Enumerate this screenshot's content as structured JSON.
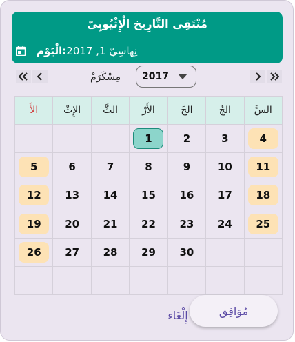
{
  "header": {
    "title": "مُنْتَقِي التَّارِيخ الْإِثْيُوبِيّ",
    "today_label": "الْيَوْم:",
    "today_value": "نِهاسِيّ 1, 2017"
  },
  "nav": {
    "year_label": "مِسْكَرَمْ",
    "year_value": "2017",
    "prev_year": "«",
    "prev_month": "‹",
    "next_month": "›",
    "next_year": "»"
  },
  "weekdays": [
    "السَّ",
    "الجُ",
    "الخَ",
    "الأَرْ",
    "الثَّ",
    "الإِثْ",
    "الأَ"
  ],
  "days": [
    [
      "4",
      "3",
      "2",
      "1",
      "",
      "",
      ""
    ],
    [
      "11",
      "10",
      "9",
      "8",
      "7",
      "6",
      "5"
    ],
    [
      "18",
      "17",
      "16",
      "15",
      "14",
      "13",
      "12"
    ],
    [
      "25",
      "24",
      "23",
      "22",
      "21",
      "20",
      "19"
    ],
    [
      "",
      "",
      "30",
      "29",
      "28",
      "27",
      "26"
    ],
    [
      "",
      "",
      "",
      "",
      "",
      "",
      ""
    ]
  ],
  "selected_day": "1",
  "colors": {
    "header": "#009a86",
    "weekend": "#fde2b5",
    "selected": "#8cd5cb",
    "friday_header": "#d03a3a",
    "action_text": "#5b4aa5"
  },
  "actions": {
    "ok": "مُوَافِق",
    "cancel": "إِلْغَاء"
  }
}
